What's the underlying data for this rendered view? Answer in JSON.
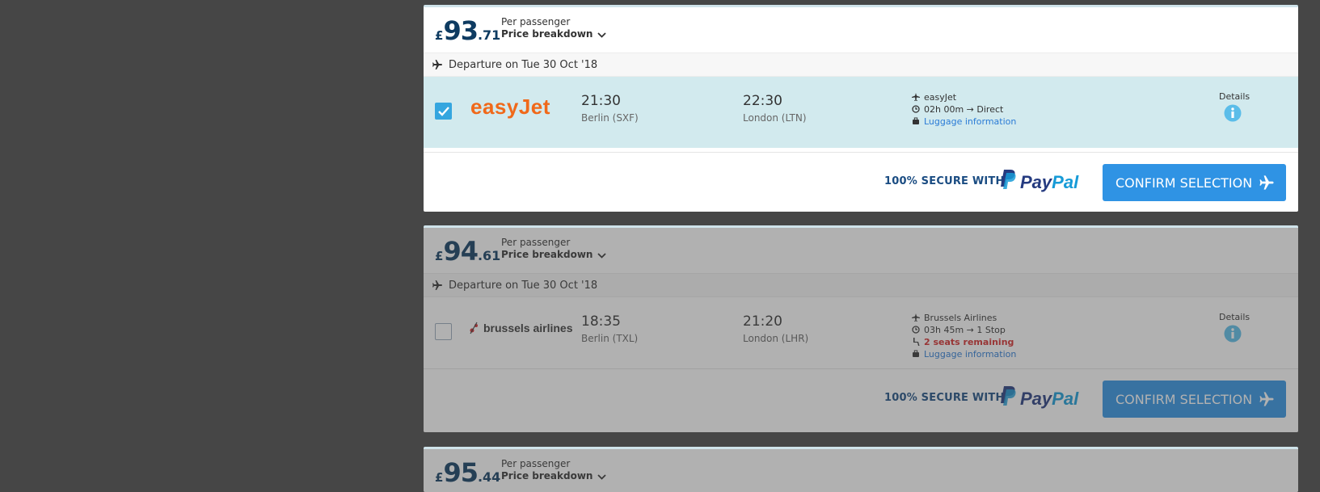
{
  "results": [
    {
      "price": {
        "currency": "£",
        "whole": "93",
        "decimal": ".71"
      },
      "per_passenger": "Per passenger",
      "price_breakdown": "Price breakdown",
      "departure": "Departure on Tue 30 Oct '18",
      "airline_logo": "easyJet",
      "selected": true,
      "dep_time": "21:30",
      "dep_place": "Berlin (SXF)",
      "arr_time": "22:30",
      "arr_place": "London (LTN)",
      "operator": "easyJet",
      "duration": "02h 00m → Direct",
      "luggage": "Luggage information",
      "details": "Details",
      "secure": "100% SECURE WITH",
      "paypal_pay": "Pay",
      "paypal_pal": "Pal",
      "confirm": "CONFIRM SELECTION"
    },
    {
      "price": {
        "currency": "£",
        "whole": "94",
        "decimal": ".61"
      },
      "per_passenger": "Per passenger",
      "price_breakdown": "Price breakdown",
      "departure": "Departure on Tue 30 Oct '18",
      "airline_logo": "brussels airlines",
      "selected": false,
      "dep_time": "18:35",
      "dep_place": "Berlin (TXL)",
      "arr_time": "21:20",
      "arr_place": "London (LHR)",
      "operator": "Brussels Airlines",
      "duration": "03h 45m → 1 Stop",
      "seats": "2 seats remaining",
      "luggage": "Luggage information",
      "details": "Details",
      "secure": "100% SECURE WITH",
      "paypal_pay": "Pay",
      "paypal_pal": "Pal",
      "confirm": "CONFIRM SELECTION"
    },
    {
      "price": {
        "currency": "£",
        "whole": "95",
        "decimal": ".44"
      },
      "per_passenger": "Per passenger",
      "price_breakdown": "Price breakdown"
    }
  ],
  "colors": {
    "accent": "#2f93e4",
    "selected_row": "#d2eaee",
    "price": "#0e3b61",
    "easyjet": "#f0691a",
    "warning": "#d42a2a",
    "link": "#2a7bd6"
  }
}
